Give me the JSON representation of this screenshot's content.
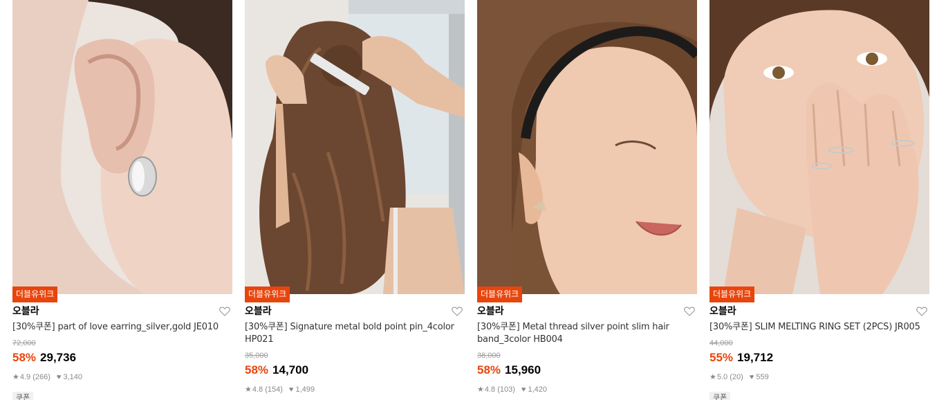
{
  "products": [
    {
      "badge": "더블유위크",
      "brand": "오블라",
      "name": "[30%쿠폰] part of love earring_silver,gold JE010",
      "original_price": "72,000",
      "discount": "58%",
      "price": "29,736",
      "rating": "4.9",
      "reviews": "(266)",
      "likes": "3,140",
      "coupon": "쿠폰"
    },
    {
      "badge": "더블유위크",
      "brand": "오블라",
      "name": "[30%쿠폰] Signature metal bold point pin_4color HP021",
      "original_price": "35,000",
      "discount": "58%",
      "price": "14,700",
      "rating": "4.8",
      "reviews": "(154)",
      "likes": "1,499",
      "coupon": ""
    },
    {
      "badge": "더블유위크",
      "brand": "오블라",
      "name": "[30%쿠폰] Metal thread silver point slim hair band_3color HB004",
      "original_price": "38,000",
      "discount": "58%",
      "price": "15,960",
      "rating": "4.8",
      "reviews": "(103)",
      "likes": "1,420",
      "coupon": ""
    },
    {
      "badge": "더블유위크",
      "brand": "오블라",
      "name": "[30%쿠폰] SLIM MELTING RING SET (2PCS) JR005",
      "original_price": "44,000",
      "discount": "55%",
      "price": "19,712",
      "rating": "5.0",
      "reviews": "(20)",
      "likes": "559",
      "coupon": "쿠폰"
    }
  ],
  "icons": {
    "wishlist": "heart-outline-icon",
    "rating": "star-icon",
    "likes": "heart-filled-icon"
  },
  "colors": {
    "accent": "#e8450c",
    "muted": "#8a8a8a"
  }
}
